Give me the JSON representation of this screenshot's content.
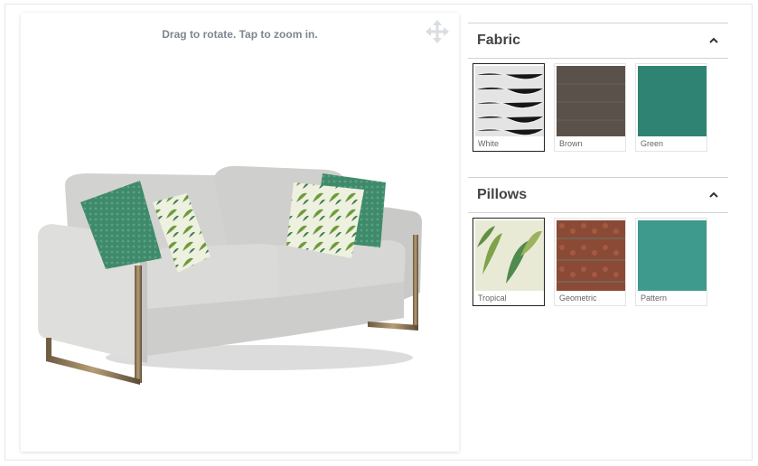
{
  "viewer": {
    "hint": "Drag to rotate. Tap to zoom in.",
    "icons": {
      "move": "move-arrows-icon"
    }
  },
  "fabric": {
    "title": "Fabric",
    "icon": "chevron-up-icon",
    "options": [
      {
        "name": "White",
        "selected": true,
        "color": "#e6e6e6"
      },
      {
        "name": "Brown",
        "selected": false,
        "color": "#5b514b"
      },
      {
        "name": "Green",
        "selected": false,
        "color": "#2f8372"
      }
    ]
  },
  "pillows": {
    "title": "Pillows",
    "icon": "chevron-up-icon",
    "options": [
      {
        "name": "Tropical",
        "selected": true,
        "color": "#8fa860"
      },
      {
        "name": "Geometric",
        "selected": false,
        "color": "#8a4a36"
      },
      {
        "name": "Pattern",
        "selected": false,
        "color": "#3e9a8c"
      }
    ]
  }
}
